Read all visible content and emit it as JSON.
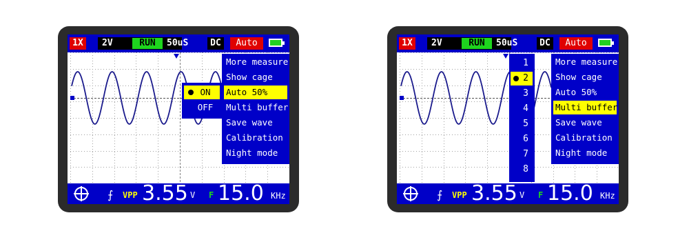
{
  "colors": {
    "bezel": "#2b2b2b",
    "bar_blue": "#0000c8",
    "highlight_yellow": "#ffff00",
    "run_green": "#1ed51e",
    "alert_red": "#e00000",
    "trace_blue": "#1a1a8c"
  },
  "icons": [
    "position-marker-icon",
    "trigger-marker-icon",
    "battery-icon",
    "crosshair-icon",
    "rising-edge-icon",
    "selected-dot-icon"
  ],
  "device_left": {
    "topbar": {
      "probe": "1X",
      "volts_div": "2V",
      "run": "RUN",
      "timebase": "50uS",
      "coupling": "DC",
      "trigger_mode": "Auto"
    },
    "menu": [
      "More measure",
      "Show cage",
      "Auto 50%",
      "Multi buffer",
      "Save wave",
      "Calibration",
      "Night mode"
    ],
    "menu_selected": "Auto 50%",
    "submenu": {
      "on": "ON",
      "off": "OFF",
      "selected": "ON"
    },
    "bottom": {
      "vpp_label": "VPP",
      "vpp_value": "3.55",
      "vpp_unit": "V",
      "freq_label": "F",
      "freq_value": "15.0",
      "freq_unit": "KHz"
    }
  },
  "device_right": {
    "topbar": {
      "probe": "1X",
      "volts_div": "2V",
      "run": "RUN",
      "timebase": "50uS",
      "coupling": "DC",
      "trigger_mode": "Auto"
    },
    "buffer_numbers": [
      "1",
      "2",
      "3",
      "4",
      "5",
      "6",
      "7",
      "8"
    ],
    "buffer_selected": "2",
    "menu": [
      "More measure",
      "Show cage",
      "Auto 50%",
      "Multi buffer",
      "Save wave",
      "Calibration",
      "Night mode"
    ],
    "menu_selected": "Multi buffer",
    "bottom": {
      "vpp_label": "VPP",
      "vpp_value": "3.55",
      "vpp_unit": "V",
      "freq_label": "F",
      "freq_value": "15.0",
      "freq_unit": "KHz"
    }
  }
}
